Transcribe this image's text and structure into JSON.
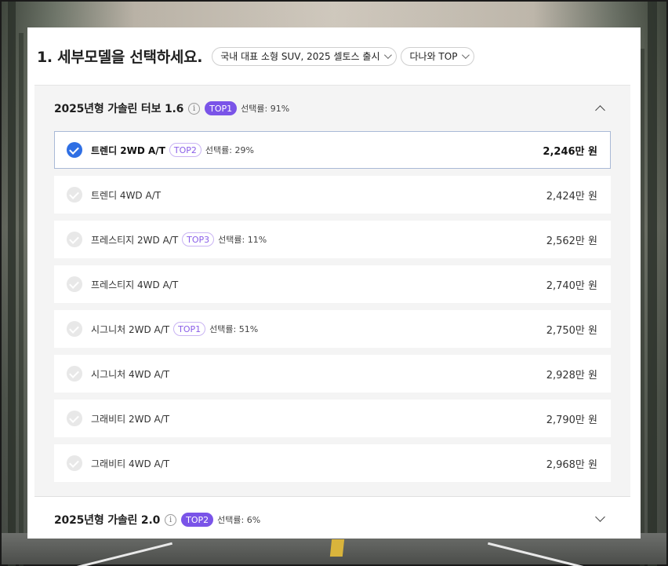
{
  "page": {
    "title": "1. 세부모델을 선택하세요."
  },
  "filters": [
    {
      "label": "국내 대표 소형 SUV, 2025 셀토스 출시"
    },
    {
      "label": "다나와 TOP"
    }
  ],
  "sections": [
    {
      "title": "2025년형 가솔린 터보 1.6",
      "info_icon": "i",
      "badge": "TOP1",
      "rate": "선택률: 91%",
      "expanded": true,
      "items": [
        {
          "name": "트렌디 2WD A/T",
          "badge": "TOP2",
          "rate": "선택률: 29%",
          "price": "2,246만 원",
          "selected": true
        },
        {
          "name": "트렌디 4WD A/T",
          "badge": "",
          "rate": "",
          "price": "2,424만 원",
          "selected": false
        },
        {
          "name": "프레스티지 2WD A/T",
          "badge": "TOP3",
          "rate": "선택률: 11%",
          "price": "2,562만 원",
          "selected": false
        },
        {
          "name": "프레스티지 4WD A/T",
          "badge": "",
          "rate": "",
          "price": "2,740만 원",
          "selected": false
        },
        {
          "name": "시그니처 2WD A/T",
          "badge": "TOP1",
          "rate": "선택률: 51%",
          "price": "2,750만 원",
          "selected": false
        },
        {
          "name": "시그니처 4WD A/T",
          "badge": "",
          "rate": "",
          "price": "2,928만 원",
          "selected": false
        },
        {
          "name": "그래비티 2WD A/T",
          "badge": "",
          "rate": "",
          "price": "2,790만 원",
          "selected": false
        },
        {
          "name": "그래비티 4WD A/T",
          "badge": "",
          "rate": "",
          "price": "2,968만 원",
          "selected": false
        }
      ]
    },
    {
      "title": "2025년형 가솔린 2.0",
      "info_icon": "i",
      "badge": "TOP2",
      "rate": "선택률: 6%",
      "expanded": false
    }
  ],
  "colors": {
    "accent_purple": "#7a54e8",
    "check_blue": "#2f6fe4",
    "selected_border": "#a9b9d6"
  }
}
